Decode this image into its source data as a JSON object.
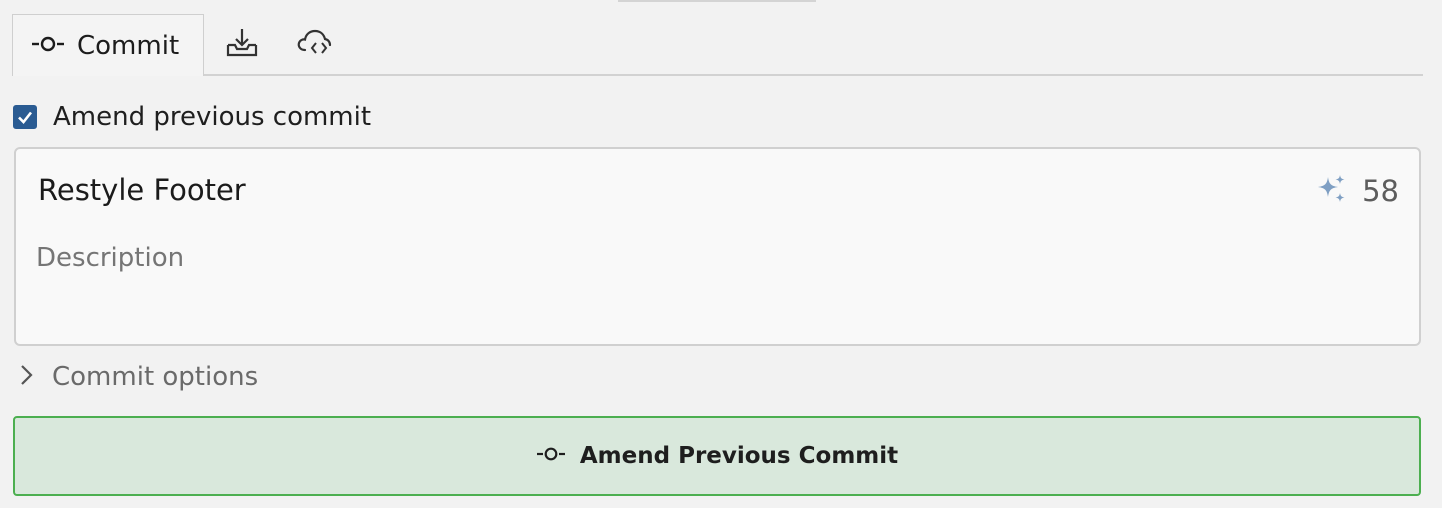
{
  "tabs": {
    "commit_label": "Commit",
    "commit_icon": "commit-icon",
    "download_icon": "inbox-download-icon",
    "cloud_icon": "cloud-code-icon"
  },
  "amend": {
    "checked": true,
    "label": "Amend previous commit"
  },
  "message": {
    "summary": "Restyle Footer",
    "char_count": "58",
    "description_placeholder": "Description",
    "ai_icon": "sparkle-icon",
    "ai_icon_color": "#7f9fc3"
  },
  "options": {
    "label": "Commit options",
    "expanded": false
  },
  "action_button": {
    "label": "Amend Previous Commit",
    "border_color": "#4caf50",
    "background_color": "#d9e8dc"
  }
}
